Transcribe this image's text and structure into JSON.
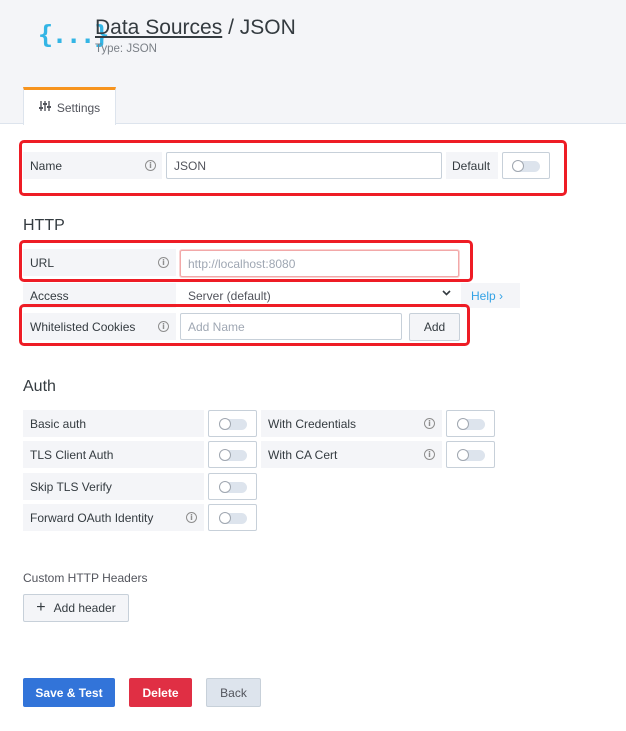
{
  "header": {
    "breadcrumb_link": "Data Sources",
    "breadcrumb_sep": " / ",
    "page_title": "JSON",
    "subtitle": "Type: JSON",
    "logo": "{...}"
  },
  "tabs": [
    {
      "label": "Settings",
      "icon": "sliders-icon",
      "active": true
    }
  ],
  "name_row": {
    "label": "Name",
    "value": "JSON",
    "default_label": "Default"
  },
  "http": {
    "title": "HTTP",
    "url_label": "URL",
    "url_placeholder": "http://localhost:8080",
    "access_label": "Access",
    "access_value": "Server (default)",
    "help_label": "Help ›",
    "cookies_label": "Whitelisted Cookies",
    "cookies_placeholder": "Add Name",
    "add_label": "Add"
  },
  "auth": {
    "title": "Auth",
    "basic_auth": "Basic auth",
    "with_credentials": "With Credentials",
    "tls_client_auth": "TLS Client Auth",
    "with_ca_cert": "With CA Cert",
    "skip_tls_verify": "Skip TLS Verify",
    "forward_oauth": "Forward OAuth Identity"
  },
  "headers": {
    "title": "Custom HTTP Headers",
    "add_header": "Add header"
  },
  "actions": {
    "save_test": "Save & Test",
    "delete": "Delete",
    "back": "Back"
  },
  "colors": {
    "accent_orange": "#f7941e",
    "primary_blue": "#3274d9",
    "danger_red": "#e02f44",
    "highlight_red": "#ee1c25"
  }
}
